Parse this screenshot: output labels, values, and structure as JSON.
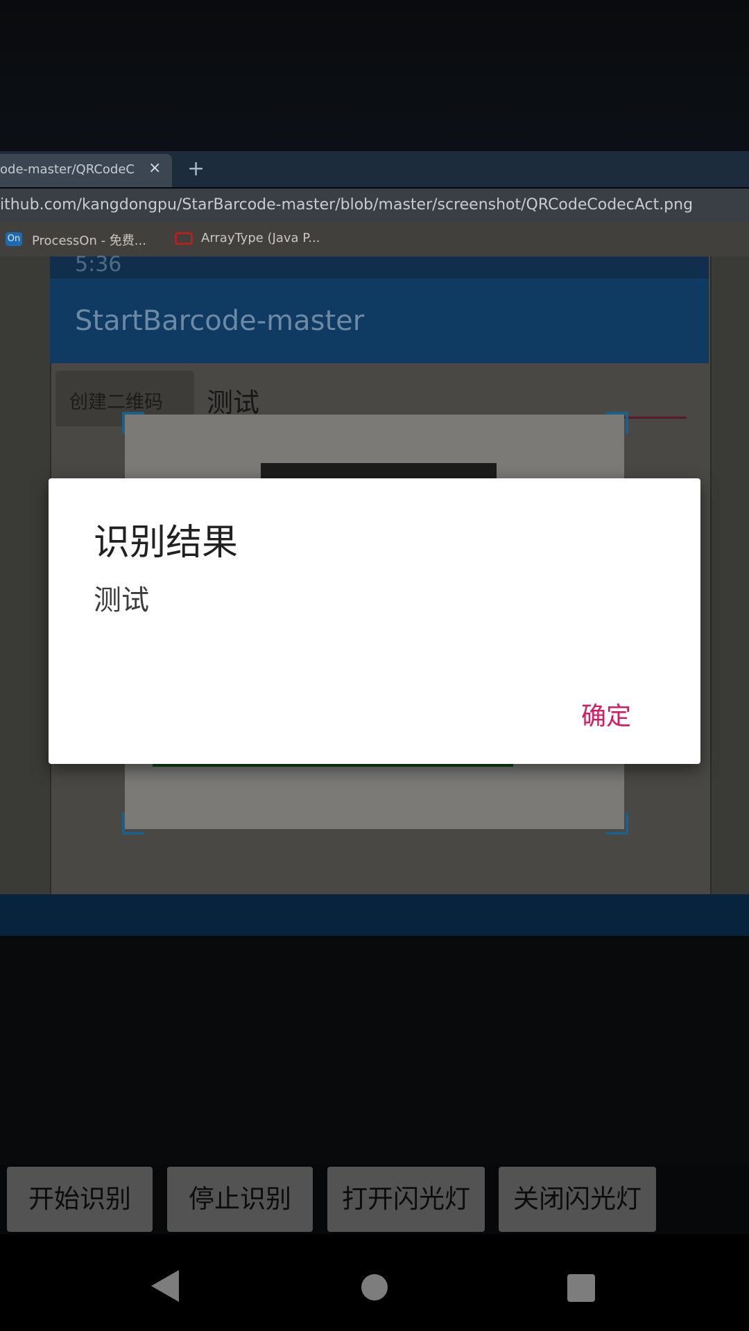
{
  "browser": {
    "tab_title": "ode-master/QRCodeC",
    "tab_close": "×",
    "new_tab": "+",
    "url": "ithub.com/kangdongpu/StarBarcode-master/blob/master/screenshot/QRCodeCodecAct.png",
    "bookmarks": [
      {
        "label": "ProcessOn - 免费...",
        "icon": "processon-icon",
        "icon_text": "On"
      },
      {
        "label": "ArrayType (Java P...",
        "icon": "oracle-icon"
      }
    ]
  },
  "screenshot_content": {
    "status_time": "5:36",
    "app_title": "StartBarcode-master",
    "create_button": "创建二维码",
    "input_text": "测试"
  },
  "dialog": {
    "title": "识别结果",
    "message": "测试",
    "confirm": "确定",
    "confirm_color": "#d81b60"
  },
  "actions": {
    "start": "开始识别",
    "stop": "停止识别",
    "flash_on": "打开闪光灯",
    "flash_off": "关闭闪光灯"
  },
  "navbar": {
    "back": "back-icon",
    "home": "home-icon",
    "recents": "recents-icon"
  }
}
